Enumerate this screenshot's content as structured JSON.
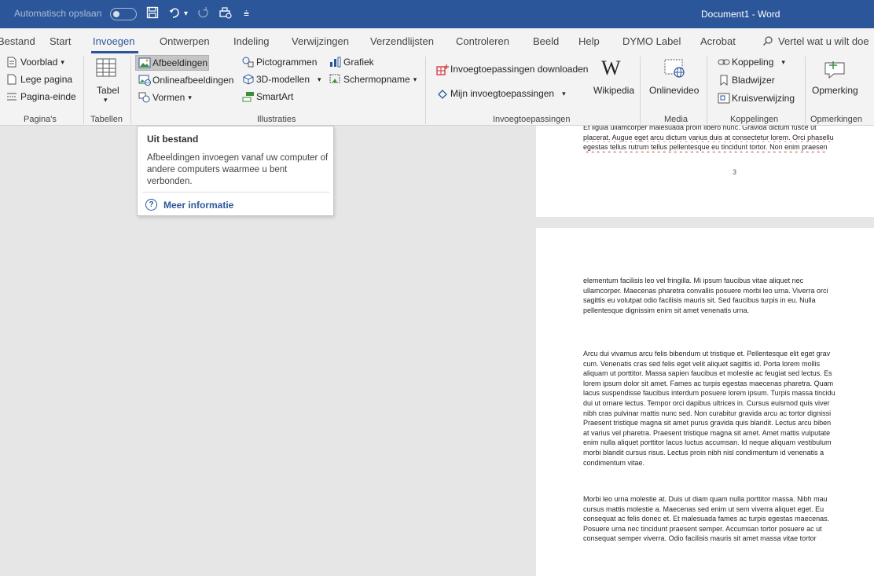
{
  "titlebar": {
    "autosave_label": "Automatisch opslaan",
    "autosave_state": "Uit",
    "document_title": "Document1  -  Word"
  },
  "tabs": [
    {
      "label": "Bestand"
    },
    {
      "label": "Start"
    },
    {
      "label": "Invoegen",
      "active": true
    },
    {
      "label": "Ontwerpen"
    },
    {
      "label": "Indeling"
    },
    {
      "label": "Verwijzingen"
    },
    {
      "label": "Verzendlijsten"
    },
    {
      "label": "Controleren"
    },
    {
      "label": "Beeld"
    },
    {
      "label": "Help"
    },
    {
      "label": "DYMO Label"
    },
    {
      "label": "Acrobat"
    },
    {
      "label": "Vertel wat u wilt doe"
    }
  ],
  "ribbon": {
    "pages": {
      "cover": "Voorblad",
      "blank": "Lege pagina",
      "break": "Pagina-einde",
      "group": "Pagina's"
    },
    "tables": {
      "table": "Tabel",
      "group": "Tabellen"
    },
    "illustrations": {
      "pictures": "Afbeeldingen",
      "online_pictures": "Onlineafbeeldingen",
      "shapes": "Vormen",
      "icons": "Pictogrammen",
      "models": "3D-modellen",
      "smartart": "SmartArt",
      "chart": "Grafiek",
      "screenshot": "Schermopname",
      "group": "Illustraties"
    },
    "addins": {
      "download": "Invoegtoepassingen downloaden",
      "mine": "Mijn invoegtoepassingen",
      "wikipedia": "Wikipedia",
      "group": "Invoegtoepassingen"
    },
    "media": {
      "online_video": "Onlinevideo",
      "group": "Media"
    },
    "links": {
      "link": "Koppeling",
      "bookmark": "Bladwijzer",
      "crossref": "Kruisverwijzing",
      "group": "Koppelingen"
    },
    "comments": {
      "comment": "Opmerking",
      "group": "Opmerkingen"
    }
  },
  "tooltip": {
    "title": "Uit bestand",
    "body": "Afbeeldingen invoegen vanaf uw computer of andere computers waarmee u bent verbonden.",
    "link": "Meer informatie"
  },
  "page1": {
    "lines": [
      "Et ligula ullamcorper malesuada proin libero nunc. Gravida dictum fusce ut",
      "placerat. Augue eget arcu dictum varius duis at consectetur lorem. Orci phasellu",
      "egestas tellus rutrum tellus pellentesque eu tincidunt tortor. Non enim praesen"
    ],
    "page_number": "3"
  },
  "page2": {
    "para1": [
      "elementum facilisis leo vel fringilla. Mi ipsum faucibus vitae aliquet nec",
      "ullamcorper. Maecenas pharetra convallis posuere morbi leo urna. Viverra orci",
      "sagittis eu volutpat odio facilisis mauris sit. Sed faucibus turpis in eu. Nulla",
      "pellentesque dignissim enim sit amet venenatis urna."
    ],
    "para2": [
      "Arcu dui vivamus arcu felis bibendum ut tristique et. Pellentesque elit eget grav",
      "cum. Venenatis cras sed felis eget velit aliquet sagittis id. Porta lorem mollis",
      "aliquam ut porttitor. Massa sapien faucibus et molestie ac feugiat sed lectus. Es",
      "lorem ipsum dolor sit amet. Fames ac turpis egestas maecenas pharetra. Quam",
      "lacus suspendisse faucibus interdum posuere lorem ipsum. Turpis massa tincidu",
      "dui ut ornare lectus. Tempor orci dapibus ultrices in. Cursus euismod quis viver",
      "nibh cras pulvinar mattis nunc sed. Non curabitur gravida arcu ac tortor dignissi",
      "Praesent tristique magna sit amet purus gravida quis blandit. Lectus arcu biben",
      "at varius vel pharetra. Praesent tristique magna sit amet. Amet mattis vulputate",
      "enim nulla aliquet porttitor lacus luctus accumsan. Id neque aliquam vestibulum",
      "morbi blandit cursus risus. Lectus proin nibh nisl condimentum id venenatis a",
      "condimentum vitae."
    ],
    "para3": [
      "Morbi leo urna molestie at. Duis ut diam quam nulla porttitor massa. Nibh mau",
      "cursus mattis molestie a. Maecenas sed enim ut sem viverra aliquet eget. Eu",
      "consequat ac felis donec et. Et malesuada fames ac turpis egestas maecenas.",
      "Posuere urna nec tincidunt praesent semper. Accumsan tortor posuere ac ut",
      "consequat semper viverra. Odio facilisis mauris sit amet massa vitae tortor"
    ]
  }
}
